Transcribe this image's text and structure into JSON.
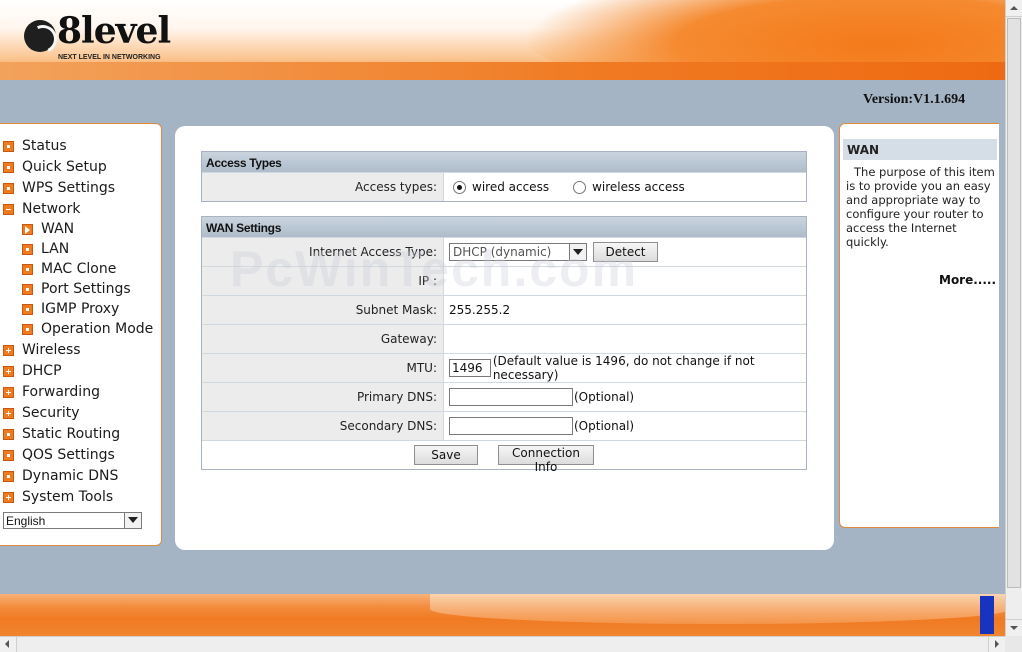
{
  "brand": {
    "logo_text": "8level",
    "tagline": "NEXT LEVEL IN NETWORKING"
  },
  "version": "Version:V1.1.694",
  "sidebar": {
    "items": [
      {
        "label": "Status",
        "icon": "bullet-icon"
      },
      {
        "label": "Quick Setup",
        "icon": "bullet-icon"
      },
      {
        "label": "WPS Settings",
        "icon": "bullet-icon"
      },
      {
        "label": "Network",
        "icon": "collapse-icon"
      },
      {
        "label": "WAN",
        "icon": "arrow-icon",
        "sub": true,
        "selected": true
      },
      {
        "label": "LAN",
        "icon": "bullet-icon",
        "sub": true
      },
      {
        "label": "MAC Clone",
        "icon": "bullet-icon",
        "sub": true
      },
      {
        "label": "Port Settings",
        "icon": "bullet-icon",
        "sub": true
      },
      {
        "label": "IGMP Proxy",
        "icon": "bullet-icon",
        "sub": true
      },
      {
        "label": "Operation Mode",
        "icon": "bullet-icon",
        "sub": true
      },
      {
        "label": "Wireless",
        "icon": "expand-icon"
      },
      {
        "label": "DHCP",
        "icon": "expand-icon"
      },
      {
        "label": "Forwarding",
        "icon": "expand-icon"
      },
      {
        "label": "Security",
        "icon": "expand-icon"
      },
      {
        "label": "Static Routing",
        "icon": "bullet-icon"
      },
      {
        "label": "QOS Settings",
        "icon": "bullet-icon"
      },
      {
        "label": "Dynamic DNS",
        "icon": "bullet-icon"
      },
      {
        "label": "System Tools",
        "icon": "expand-icon"
      }
    ],
    "language": "English"
  },
  "access_types": {
    "title": "Access Types",
    "label": "Access types:",
    "options": [
      {
        "label": "wired access",
        "checked": true
      },
      {
        "label": "wireless access",
        "checked": false
      }
    ]
  },
  "wan": {
    "title": "WAN Settings",
    "internet_access_type_label": "Internet Access Type:",
    "internet_access_type_value": "DHCP (dynamic)",
    "detect_button": "Detect",
    "ip_label": "IP :",
    "ip_value": "",
    "subnet_label": "Subnet Mask:",
    "subnet_value": "255.255.2",
    "gateway_label": "Gateway:",
    "gateway_value": "",
    "mtu_label": "MTU:",
    "mtu_value": "1496",
    "mtu_note": "(Default value is 1496, do not change if not necessary)",
    "primary_dns_label": "Primary DNS:",
    "primary_dns_value": "",
    "primary_dns_note": "(Optional)",
    "secondary_dns_label": "Secondary DNS:",
    "secondary_dns_value": "",
    "secondary_dns_note": "(Optional)",
    "save_button": "Save",
    "connection_info_button": "Connection Info"
  },
  "help": {
    "title": "WAN",
    "text": "The purpose of this item is to provide you an easy and appropriate way to configure your router to access the Internet quickly.",
    "more": "More....."
  },
  "watermark": "PcWinTech.com",
  "colors": {
    "accent": "#f07a1e",
    "background": "#a4b4c4",
    "section_header": "#aebccb"
  }
}
